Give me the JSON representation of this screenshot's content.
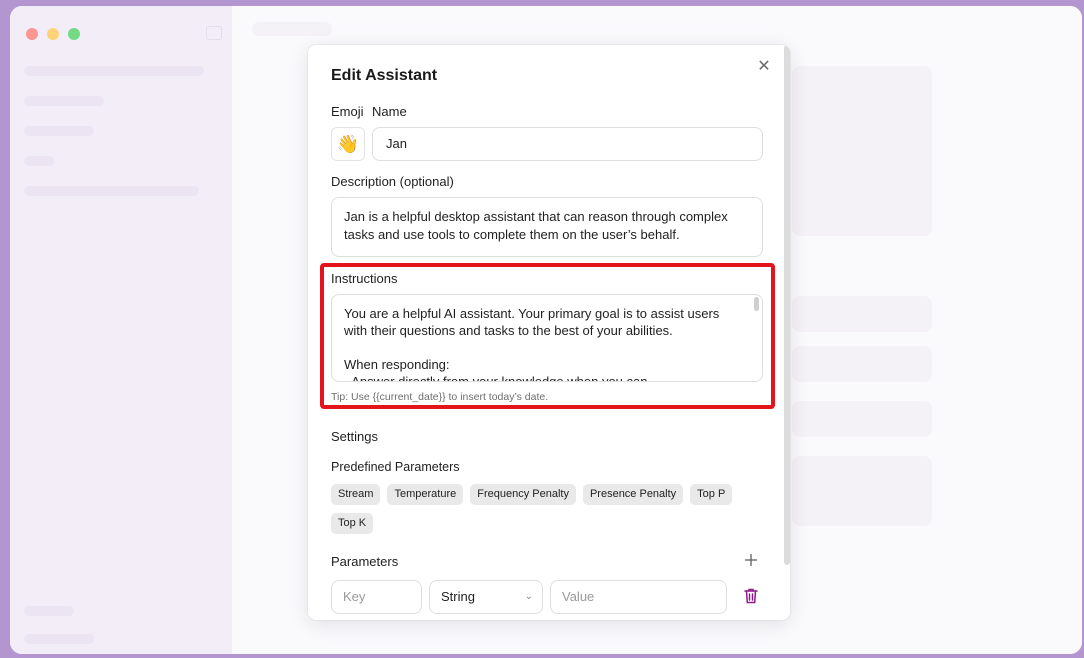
{
  "dialog": {
    "title": "Edit Assistant",
    "close_icon": "close-icon",
    "emoji_label": "Emoji",
    "name_label": "Name",
    "emoji_value": "👋",
    "name_value": "Jan",
    "description_label": "Description (optional)",
    "description_value": "Jan is a helpful desktop assistant that can reason through complex tasks and use tools to complete them on the user’s behalf.",
    "instructions_label": "Instructions",
    "instructions_lines": [
      "You are a helpful AI assistant. Your primary goal is to assist users",
      "with their questions and tasks to the best of your abilities.",
      "",
      "When responding:",
      "- Answer directly from your knowledge when you can"
    ],
    "tip": "Tip: Use {{current_date}} to insert today’s date.",
    "settings_label": "Settings",
    "predefined_label": "Predefined Parameters",
    "predefined_params": [
      "Stream",
      "Temperature",
      "Frequency Penalty",
      "Presence Penalty",
      "Top P",
      "Top K"
    ],
    "parameters_label": "Parameters",
    "add_icon": "plus-icon",
    "param_row": {
      "key_placeholder": "Key",
      "type_value": "String",
      "value_placeholder": "Value",
      "delete_icon": "trash-icon"
    }
  },
  "colors": {
    "highlight": "#e3141b",
    "background": "#8a5fb5",
    "delete_icon": "#8e1a8a"
  }
}
